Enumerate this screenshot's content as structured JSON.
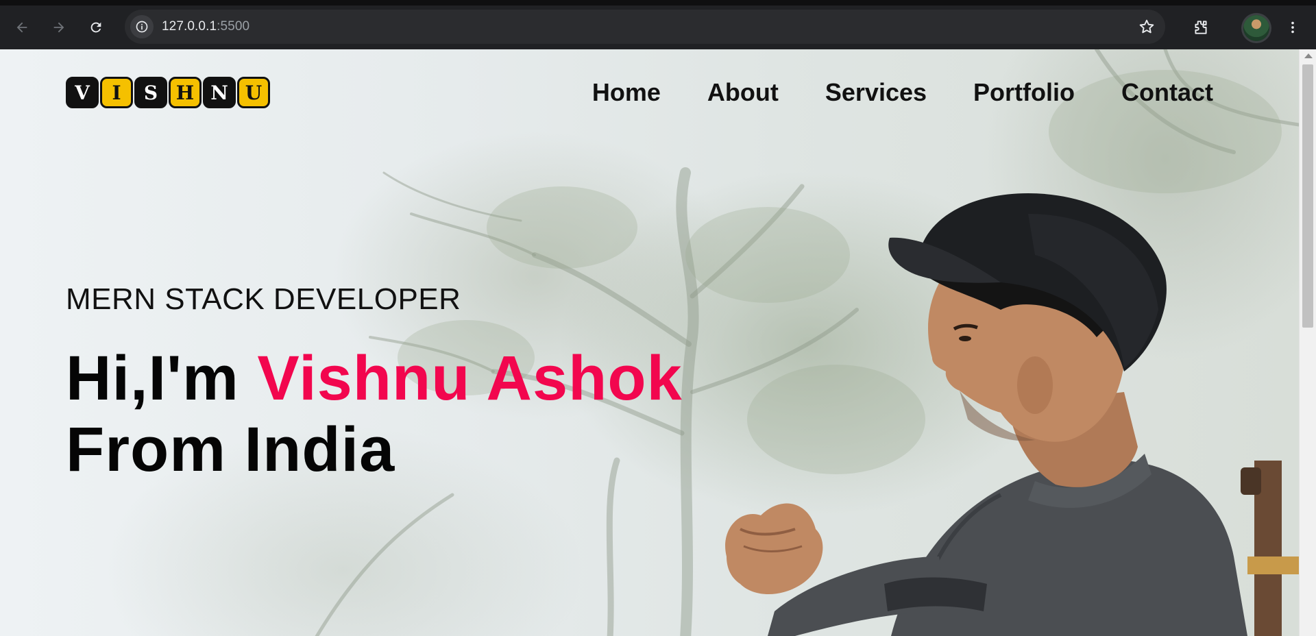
{
  "browser": {
    "url_host": "127.0.0.1",
    "url_port": ":5500",
    "icons": [
      "back-arrow-icon",
      "forward-arrow-icon",
      "reload-icon",
      "site-info-icon",
      "bookmark-star-icon",
      "extensions-icon",
      "profile-avatar",
      "kebab-menu-icon"
    ]
  },
  "logo": {
    "letters": [
      "V",
      "I",
      "S",
      "H",
      "N",
      "U"
    ]
  },
  "nav": {
    "items": [
      "Home",
      "About",
      "Services",
      "Portfolio",
      "Contact"
    ]
  },
  "hero": {
    "role": "MERN STACK DEVELOPER",
    "greeting": "Hi,I'm",
    "name": "Vishnu Ashok",
    "origin": "From India"
  },
  "colors": {
    "accent": "#f2064e",
    "logo_yellow": "#f5c000",
    "logo_dark": "#111111",
    "text": "#050505"
  }
}
